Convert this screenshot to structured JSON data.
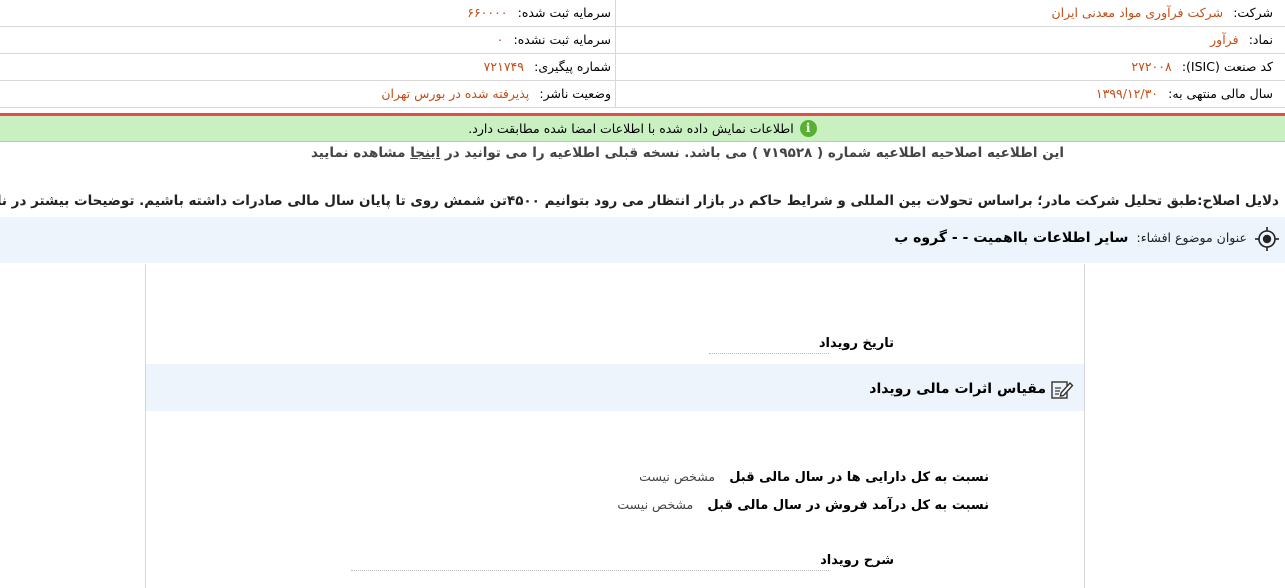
{
  "info": {
    "company_label": "شرکت:",
    "company_value": "شرکت فرآوری مواد معدنی ایران",
    "registered_capital_label": "سرمایه ثبت شده:",
    "registered_capital_value": "۶۶۰۰۰۰",
    "symbol_label": "نماد:",
    "symbol_value": "فرآور",
    "unregistered_capital_label": "سرمایه ثبت نشده:",
    "unregistered_capital_value": "۰",
    "isic_label": "کد صنعت (ISIC):",
    "isic_value": "۲۷۲۰۰۸",
    "tracking_label": "شماره پیگیری:",
    "tracking_value": "۷۲۱۷۴۹",
    "fiscal_year_label": "سال مالی منتهی به:",
    "fiscal_year_value": "۱۳۹۹/۱۲/۳۰",
    "publisher_status_label": "وضعیت ناشر:",
    "publisher_status_value": "پذیرفته شده در بورس تهران"
  },
  "notice": {
    "icon": "info-icon",
    "text": "اطلاعات نمایش داده شده با اطلاعات امضا شده مطابقت دارد."
  },
  "correction": {
    "text_before": "این اطلاعیه اصلاحیه اطلاعیه شماره ( ۷۱۹۵۲۸ ) می باشد. نسخه قبلی اطلاعیه را می توانید در ",
    "link_text": "اینجا",
    "text_after": " مشاهده نمایید"
  },
  "reasons": "دلایل اصلاح:طبق تحلیل شرکت مادر؛ براساس تحولات بین المللی و شرایط حاکم در بازار انتظار می رود بتوانیم ۴۵۰۰تن شمش روی تا پایان سال مالی صادرات داشته باشیم. توضیحات بیشتر در نامه فایل ضمیمه می باشد",
  "subject": {
    "label": "عنوان موضوع افشاء:",
    "title": "سایر اطلاعات بااهمیت - - گروه ب"
  },
  "form": {
    "event_date_label": "تاریخ رویداد",
    "section_title": "مقیاس اثرات مالی رویداد",
    "ratio_assets_label": "نسبت به کل دارایی ها در سال مالی قبل",
    "ratio_assets_value": "مشخص نیست",
    "ratio_sales_label": "نسبت به کل درآمد فروش در سال مالی قبل",
    "ratio_sales_value": "مشخص نیست",
    "event_description_label": "شرح رویداد"
  },
  "colors": {
    "value_text": "#c0501a",
    "notice_bg": "#c9f0c1",
    "notice_icon": "#58b033",
    "red_line": "#e84a4a",
    "subject_bg": "#edf4fb"
  }
}
